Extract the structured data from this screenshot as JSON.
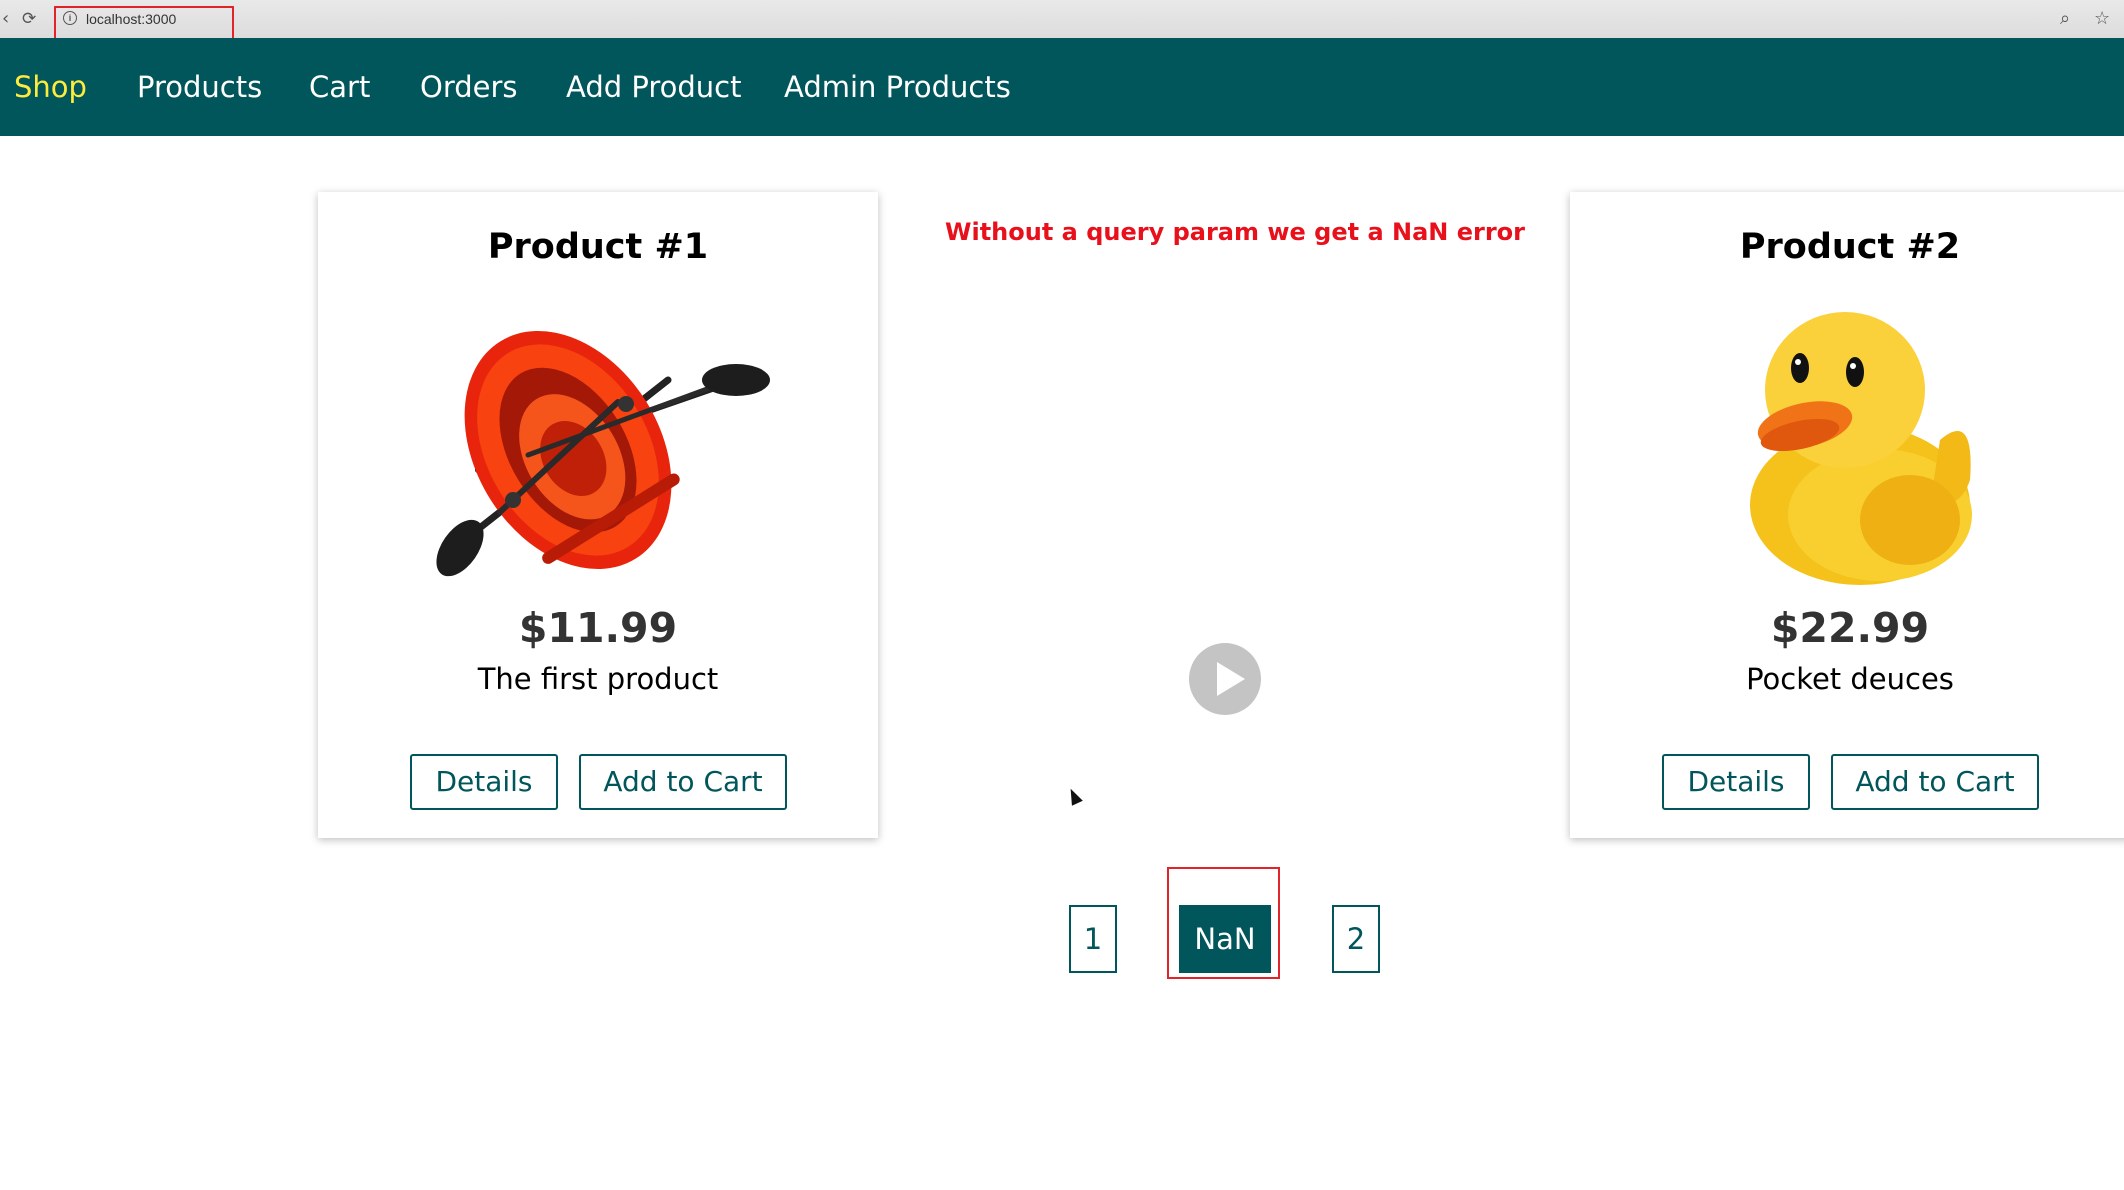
{
  "browser": {
    "url": "localhost:3000"
  },
  "nav": {
    "items": [
      {
        "label": "Shop",
        "active": true
      },
      {
        "label": "Products",
        "active": false
      },
      {
        "label": "Cart",
        "active": false
      },
      {
        "label": "Orders",
        "active": false
      },
      {
        "label": "Add Product",
        "active": false
      },
      {
        "label": "Admin Products",
        "active": false
      }
    ]
  },
  "products": [
    {
      "title": "Product #1",
      "price": "$11.99",
      "description": "The first product",
      "details_label": "Details",
      "add_to_cart_label": "Add to Cart",
      "image": "red inflatable boat with paddles"
    },
    {
      "title": "Product #2",
      "price": "$22.99",
      "description": "Pocket deuces",
      "details_label": "Details",
      "add_to_cart_label": "Add to Cart",
      "image": "yellow rubber duck"
    }
  ],
  "annotation": "Without a query param we get a NaN error",
  "pagination": {
    "pages": [
      "1",
      "NaN",
      "2"
    ],
    "active": "NaN"
  },
  "colors": {
    "brand": "#00565a",
    "active_nav": "#ffeb3b",
    "annotation": "#e8101b",
    "highlight_box": "#e0242a"
  },
  "icons": [
    "back-icon",
    "reload-icon",
    "info-icon",
    "zoom-icon",
    "bookmark-star-icon",
    "play-icon",
    "mouse-cursor-icon"
  ]
}
